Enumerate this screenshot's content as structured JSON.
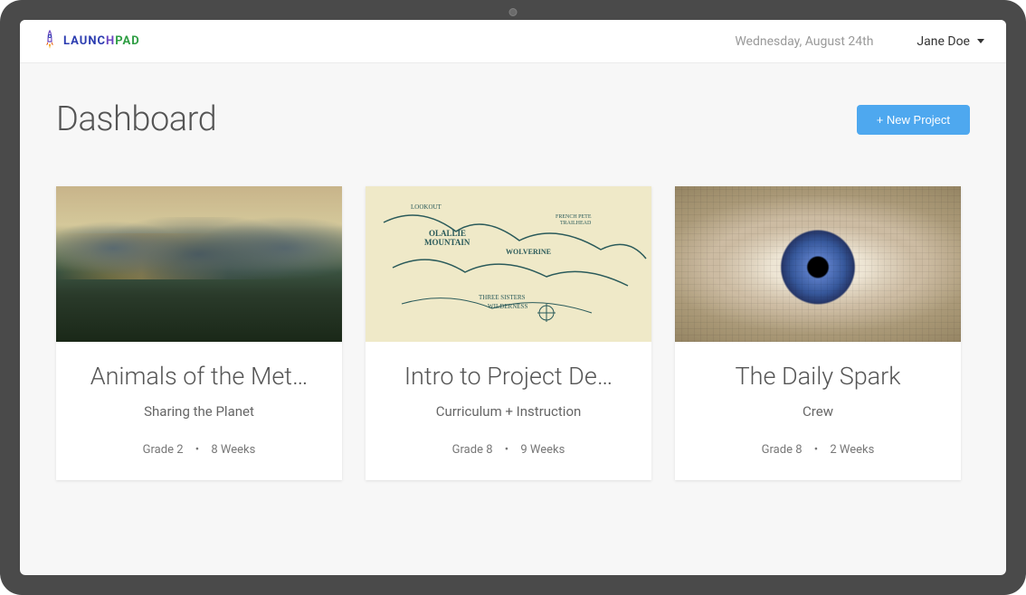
{
  "header": {
    "logo_text_1": "LAUNC",
    "logo_text_2": "H",
    "logo_text_3": "PAD",
    "date": "Wednesday, August 24th",
    "user_name": "Jane Doe"
  },
  "page": {
    "title": "Dashboard",
    "new_project_label": "+ New Project"
  },
  "projects": [
    {
      "title": "Animals of the Met…",
      "subtitle": "Sharing the Planet",
      "grade": "Grade 2",
      "duration": "8 Weeks"
    },
    {
      "title": "Intro to Project De…",
      "subtitle": "Curriculum + Instruction",
      "grade": "Grade 8",
      "duration": "9 Weeks"
    },
    {
      "title": "The Daily Spark",
      "subtitle": "Crew",
      "grade": "Grade 8",
      "duration": "2 Weeks"
    }
  ]
}
